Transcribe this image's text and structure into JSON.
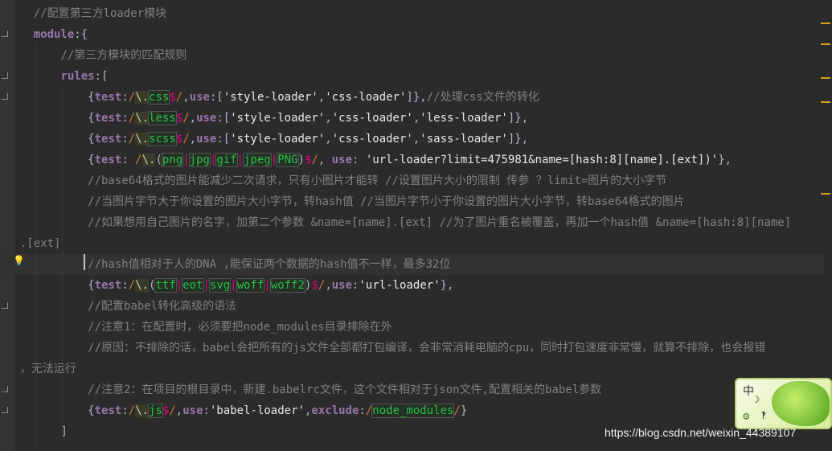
{
  "editor": {
    "lines": [
      {
        "indent": "    ",
        "parts": [
          {
            "c": "c",
            "t": "//配置第三方loader模块"
          }
        ]
      },
      {
        "indent": "    ",
        "parts": [
          {
            "c": "n",
            "t": "module"
          },
          {
            "c": "p",
            "t": ":{"
          }
        ]
      },
      {
        "indent": "        ",
        "parts": [
          {
            "c": "c",
            "t": "//第三方模块的匹配规则"
          }
        ]
      },
      {
        "indent": "        ",
        "parts": [
          {
            "c": "n",
            "t": "rules"
          },
          {
            "c": "p",
            "t": ":["
          }
        ]
      },
      {
        "indent": "            ",
        "parts": [
          {
            "c": "p",
            "t": "{"
          },
          {
            "c": "n",
            "t": "test"
          },
          {
            "c": "p",
            "t": ":"
          },
          {
            "c": "k",
            "t": "/"
          },
          {
            "c": "rxs",
            "t": "\\."
          },
          {
            "c": "rxg",
            "t": "css"
          },
          {
            "c": "rxe",
            "t": "$"
          },
          {
            "c": "k",
            "t": "/"
          },
          {
            "c": "p",
            "t": ","
          },
          {
            "c": "n",
            "t": "use"
          },
          {
            "c": "p",
            "t": ":["
          },
          {
            "c": "str",
            "t": "'style-loader'"
          },
          {
            "c": "p",
            "t": ","
          },
          {
            "c": "str",
            "t": "'css-loader'"
          },
          {
            "c": "p",
            "t": "]},"
          },
          {
            "c": "c",
            "t": "//处理css文件的转化"
          }
        ]
      },
      {
        "indent": "            ",
        "parts": [
          {
            "c": "p",
            "t": "{"
          },
          {
            "c": "n",
            "t": "test"
          },
          {
            "c": "p",
            "t": ":"
          },
          {
            "c": "k",
            "t": "/"
          },
          {
            "c": "rxs",
            "t": "\\."
          },
          {
            "c": "rxg",
            "t": "less"
          },
          {
            "c": "rxe",
            "t": "$"
          },
          {
            "c": "k",
            "t": "/"
          },
          {
            "c": "p",
            "t": ","
          },
          {
            "c": "n",
            "t": "use"
          },
          {
            "c": "p",
            "t": ":["
          },
          {
            "c": "str",
            "t": "'style-loader'"
          },
          {
            "c": "p",
            "t": ","
          },
          {
            "c": "str",
            "t": "'css-loader'"
          },
          {
            "c": "p",
            "t": ","
          },
          {
            "c": "str",
            "t": "'less-loader'"
          },
          {
            "c": "p",
            "t": "]},"
          }
        ]
      },
      {
        "indent": "            ",
        "parts": [
          {
            "c": "p",
            "t": "{"
          },
          {
            "c": "n",
            "t": "test"
          },
          {
            "c": "p",
            "t": ":"
          },
          {
            "c": "k",
            "t": "/"
          },
          {
            "c": "rxs",
            "t": "\\."
          },
          {
            "c": "rxg",
            "t": "scss"
          },
          {
            "c": "rxe",
            "t": "$"
          },
          {
            "c": "k",
            "t": "/"
          },
          {
            "c": "p",
            "t": ","
          },
          {
            "c": "n",
            "t": "use"
          },
          {
            "c": "p",
            "t": ":["
          },
          {
            "c": "str",
            "t": "'style-loader'"
          },
          {
            "c": "p",
            "t": ","
          },
          {
            "c": "str",
            "t": "'css-loader'"
          },
          {
            "c": "p",
            "t": ","
          },
          {
            "c": "str",
            "t": "'sass-loader'"
          },
          {
            "c": "p",
            "t": "]},"
          }
        ]
      },
      {
        "indent": "            ",
        "parts": [
          {
            "c": "p",
            "t": "{"
          },
          {
            "c": "n",
            "t": "test"
          },
          {
            "c": "p",
            "t": ": "
          },
          {
            "c": "k",
            "t": "/"
          },
          {
            "c": "rxs",
            "t": "\\."
          },
          {
            "c": "p",
            "t": "("
          },
          {
            "c": "rxg",
            "t": "png"
          },
          {
            "c": "rxe",
            "t": "|"
          },
          {
            "c": "rxg",
            "t": "jpg"
          },
          {
            "c": "rxe",
            "t": "|"
          },
          {
            "c": "rxg",
            "t": "gif"
          },
          {
            "c": "rxe",
            "t": "|"
          },
          {
            "c": "rxg",
            "t": "jpeg"
          },
          {
            "c": "rxe",
            "t": "|"
          },
          {
            "c": "rxg",
            "t": "PNG"
          },
          {
            "c": "p",
            "t": ")"
          },
          {
            "c": "rxe",
            "t": "$"
          },
          {
            "c": "k",
            "t": "/"
          },
          {
            "c": "p",
            "t": ", "
          },
          {
            "c": "n",
            "t": "use"
          },
          {
            "c": "p",
            "t": ": "
          },
          {
            "c": "str",
            "t": "'url-loader?limit=475981&name=[hash:8][name].[ext])'"
          },
          {
            "c": "p",
            "t": "},"
          }
        ]
      },
      {
        "indent": "            ",
        "parts": [
          {
            "c": "c",
            "t": "//base64格式的图片能减少二次请求，只有小图片才能转 //设置图片大小的限制 传参 ？limit=图片的大小字节"
          }
        ]
      },
      {
        "indent": "            ",
        "parts": [
          {
            "c": "c",
            "t": "//当图片字节大于你设置的图片大小字节，转hash值 //当图片字节小于你设置的图片大小字节，转base64格式的图片"
          }
        ]
      },
      {
        "indent": "            ",
        "parts": [
          {
            "c": "c",
            "t": "//如果想用自己图片的名字，加第二个参数 &name=[name].[ext] //为了图片重名被覆盖，再加一个hash值 &name=[hash:8][name]"
          }
        ]
      },
      {
        "indent": "  ",
        "parts": [
          {
            "c": "c",
            "t": ".[ext]"
          }
        ]
      },
      {
        "indent": "            ",
        "current": true,
        "parts": [
          {
            "c": "c",
            "t": "//hash值相对于人的DNA ,能保证两个数据的hash值不一样，最多32位"
          }
        ]
      },
      {
        "indent": "            ",
        "parts": [
          {
            "c": "p",
            "t": "{"
          },
          {
            "c": "n",
            "t": "test"
          },
          {
            "c": "p",
            "t": ":"
          },
          {
            "c": "k",
            "t": "/"
          },
          {
            "c": "rxs",
            "t": "\\."
          },
          {
            "c": "p",
            "t": "("
          },
          {
            "c": "rxg",
            "t": "ttf"
          },
          {
            "c": "rxe",
            "t": "|"
          },
          {
            "c": "rxg",
            "t": "eot"
          },
          {
            "c": "rxe",
            "t": "|"
          },
          {
            "c": "rxg",
            "t": "svg"
          },
          {
            "c": "rxe",
            "t": "|"
          },
          {
            "c": "rxg",
            "t": "woff"
          },
          {
            "c": "rxe",
            "t": "|"
          },
          {
            "c": "rxg",
            "t": "woff2"
          },
          {
            "c": "p",
            "t": ")"
          },
          {
            "c": "rxe",
            "t": "$"
          },
          {
            "c": "k",
            "t": "/"
          },
          {
            "c": "p",
            "t": ","
          },
          {
            "c": "n",
            "t": "use"
          },
          {
            "c": "p",
            "t": ":"
          },
          {
            "c": "str",
            "t": "'url-loader'"
          },
          {
            "c": "p",
            "t": "},"
          }
        ]
      },
      {
        "indent": "            ",
        "parts": [
          {
            "c": "c",
            "t": "//配置babel转化高级的语法"
          }
        ]
      },
      {
        "indent": "            ",
        "parts": [
          {
            "c": "c",
            "t": "//注意1：在配置时，必须要把node_modules目录排除在外"
          }
        ]
      },
      {
        "indent": "            ",
        "parts": [
          {
            "c": "c",
            "t": "//原因：不排除的话，babel会把所有的js文件全部都打包编译，会非常消耗电脑的cpu，同时打包速度非常慢，就算不排除，也会报错"
          }
        ]
      },
      {
        "indent": "  ",
        "parts": [
          {
            "c": "c",
            "t": "，无法运行"
          }
        ]
      },
      {
        "indent": "            ",
        "parts": [
          {
            "c": "c",
            "t": "//注意2：在项目的根目录中，新建.babelrc文件，这个文件相对于json文件,配置相关的babel参数"
          }
        ]
      },
      {
        "indent": "            ",
        "parts": [
          {
            "c": "p",
            "t": "{"
          },
          {
            "c": "n",
            "t": "test"
          },
          {
            "c": "p",
            "t": ":"
          },
          {
            "c": "k",
            "t": "/"
          },
          {
            "c": "rxs",
            "t": "\\."
          },
          {
            "c": "rxg",
            "t": "js"
          },
          {
            "c": "rxe",
            "t": "$"
          },
          {
            "c": "k",
            "t": "/"
          },
          {
            "c": "p",
            "t": ","
          },
          {
            "c": "n",
            "t": "use"
          },
          {
            "c": "p",
            "t": ":"
          },
          {
            "c": "str",
            "t": "'babel-loader'"
          },
          {
            "c": "p",
            "t": ","
          },
          {
            "c": "n",
            "t": "exclude"
          },
          {
            "c": "p",
            "t": ":"
          },
          {
            "c": "k",
            "t": "/"
          },
          {
            "c": "rxg",
            "t": "node_modules"
          },
          {
            "c": "k",
            "t": "/"
          },
          {
            "c": "p",
            "t": "}"
          }
        ]
      },
      {
        "indent": "        ",
        "parts": [
          {
            "c": "p",
            "t": "]"
          }
        ]
      }
    ]
  },
  "watermark": "https://blog.csdn.net/weixin_44389107",
  "ime_widget": {
    "label": "中"
  },
  "icons": {
    "bulb": "lightbulb-icon",
    "gear": "gear-icon",
    "moon": "moon-icon"
  }
}
